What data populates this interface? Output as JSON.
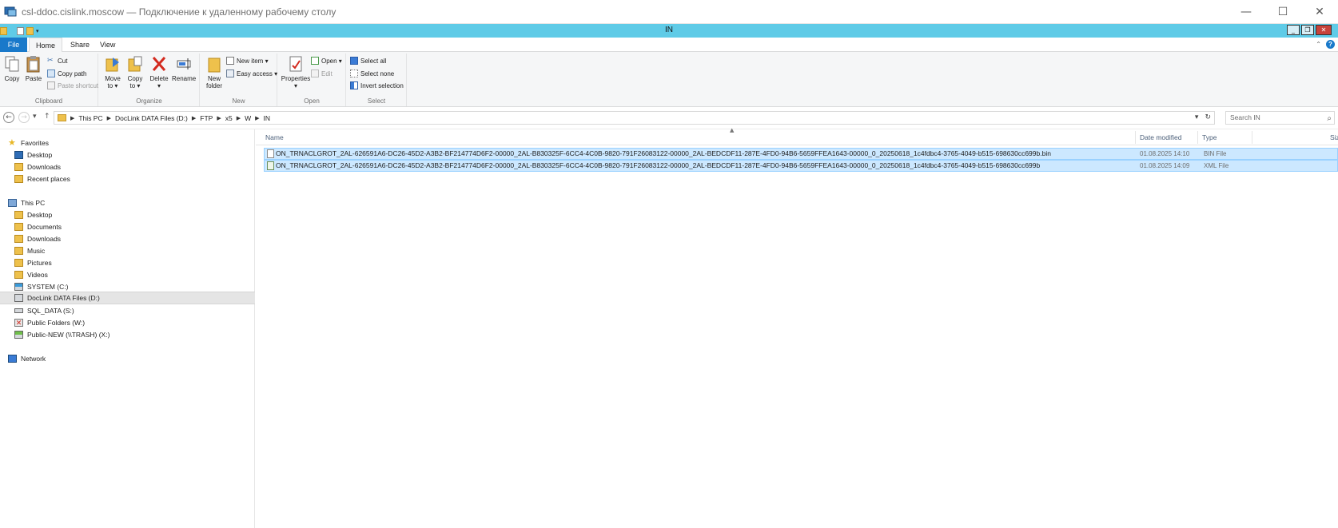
{
  "rdp": {
    "title": "csl-ddoc.cislink.moscow — Подключение к удаленному рабочему столу",
    "minimize": "—",
    "maximize": "☐",
    "close": "✕"
  },
  "explorer": {
    "title": "IN",
    "mini_min": "_",
    "mini_restore": "❐",
    "mini_close": "✕"
  },
  "tabs": {
    "file": "File",
    "home": "Home",
    "share": "Share",
    "view": "View",
    "collapse": "⌃",
    "help": "?"
  },
  "ribbon": {
    "clipboard": {
      "label": "Clipboard",
      "copy": "Copy",
      "paste": "Paste",
      "cut": "Cut",
      "copy_path": "Copy path",
      "paste_shortcut": "Paste shortcut"
    },
    "organize": {
      "label": "Organize",
      "move_to": "Move",
      "move_to_2": "to ▾",
      "copy_to": "Copy",
      "copy_to_2": "to ▾",
      "delete": "Delete",
      "delete_2": "▾",
      "rename": "Rename"
    },
    "new": {
      "label": "New",
      "new_folder": "New",
      "new_folder_2": "folder",
      "new_item": "New item ▾",
      "easy_access": "Easy access ▾"
    },
    "open": {
      "label": "Open",
      "properties": "Properties",
      "properties_2": "▾",
      "open": "Open ▾",
      "edit": "Edit"
    },
    "select": {
      "label": "Select",
      "select_all": "Select all",
      "select_none": "Select none",
      "invert_selection": "Invert selection"
    }
  },
  "address": {
    "back": "←",
    "forward": "→",
    "recent": "▾",
    "up": "↑",
    "crumbs": [
      "This PC",
      "DocLink DATA Files (D:)",
      "FTP",
      "x5",
      "W",
      "IN"
    ],
    "dropdown": "▾",
    "refresh": "↻",
    "search_placeholder": "Search IN",
    "search_icon": "⌕"
  },
  "nav": {
    "favorites": "Favorites",
    "fav_desktop": "Desktop",
    "fav_downloads": "Downloads",
    "fav_recent": "Recent places",
    "this_pc": "This PC",
    "pc_desktop": "Desktop",
    "pc_documents": "Documents",
    "pc_downloads": "Downloads",
    "pc_music": "Music",
    "pc_pictures": "Pictures",
    "pc_videos": "Videos",
    "drive_c": "SYSTEM (C:)",
    "drive_d": "DocLink DATA Files (D:)",
    "drive_s": "SQL_DATA (S:)",
    "drive_w": "Public Folders (W:)",
    "drive_x": "Public-NEW (\\\\TRASH) (X:)",
    "network": "Network"
  },
  "columns": {
    "name": "Name",
    "date_modified": "Date modified",
    "type": "Type",
    "size": "Size",
    "sort": "▲"
  },
  "files": [
    {
      "name": "ON_TRNACLGROT_2AL-626591A6-DC26-45D2-A3B2-BF214774D6F2-00000_2AL-B830325F-6CC4-4C0B-9820-791F26083122-00000_2AL-BEDCDF11-287E-4FD0-94B6-5659FFEA1643-00000_0_20250618_1c4fdbc4-3765-4049-b515-698630cc699b.bin",
      "date": "01.08.2025 14:10",
      "type": "BIN File"
    },
    {
      "name": "ON_TRNACLGROT_2AL-626591A6-DC26-45D2-A3B2-BF214774D6F2-00000_2AL-B830325F-6CC4-4C0B-9820-791F26083122-00000_2AL-BEDCDF11-287E-4FD0-94B6-5659FFEA1643-00000_0_20250618_1c4fdbc4-3765-4049-b515-698630cc699b",
      "date": "01.08.2025 14:09",
      "type": "XML File"
    }
  ],
  "colors": {
    "title_strip": "#5fcbe7",
    "file_tab": "#1979ca",
    "selection": "#cce8ff",
    "selection_border": "#99d1ff"
  }
}
